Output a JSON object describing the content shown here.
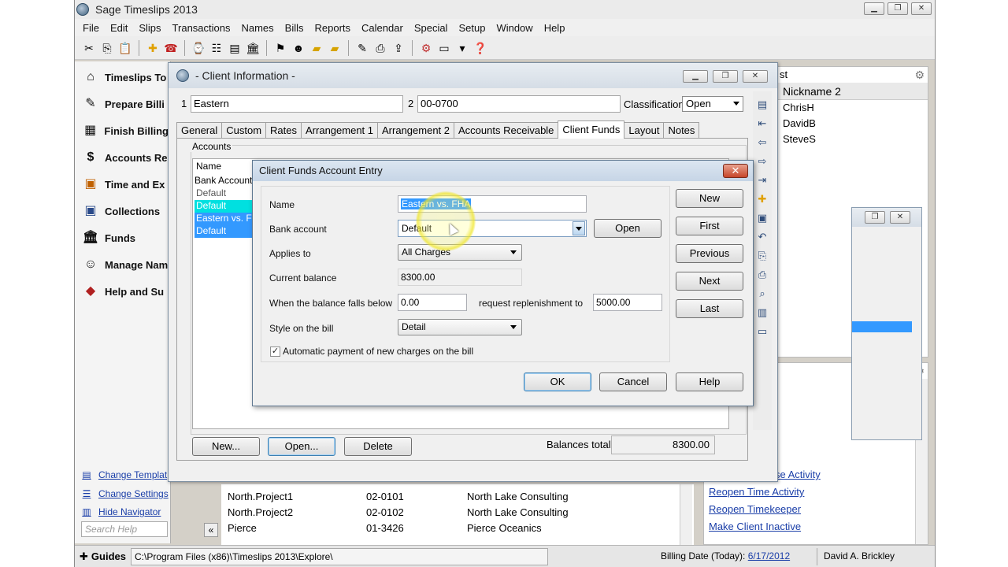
{
  "app": {
    "title": "Sage Timeslips 2013",
    "menu": [
      "File",
      "Edit",
      "Slips",
      "Transactions",
      "Names",
      "Bills",
      "Reports",
      "Calendar",
      "Special",
      "Setup",
      "Window",
      "Help"
    ]
  },
  "navigator": {
    "items": [
      {
        "label": "Timeslips To",
        "icon": "house-icon"
      },
      {
        "label": "Prepare Billi",
        "icon": "prepare-billing-icon"
      },
      {
        "label": "Finish Billing",
        "icon": "finish-billing-icon"
      },
      {
        "label": "Accounts Re",
        "icon": "accounts-receivable-icon"
      },
      {
        "label": "Time and Ex",
        "icon": "time-expense-icon"
      },
      {
        "label": "Collections",
        "icon": "collections-icon"
      },
      {
        "label": "Funds",
        "icon": "funds-icon"
      },
      {
        "label": "Manage Nam",
        "icon": "manage-names-icon"
      },
      {
        "label": "Help and Su",
        "icon": "help-support-icon"
      }
    ],
    "links": [
      "Change Templat",
      "Change Settings",
      "Hide Navigator"
    ],
    "search_placeholder": "Search Help",
    "help_button": "?",
    "collapse": "«"
  },
  "background": {
    "list_rows": [
      {
        "name": "North.Project1",
        "code": "02-0101",
        "company": "North Lake Consulting"
      },
      {
        "name": "North.Project2",
        "code": "02-0102",
        "company": "North Lake Consulting"
      },
      {
        "name": "Pierce",
        "code": "01-3426",
        "company": "Pierce Oceanics"
      }
    ],
    "right_links": [
      "se Activity",
      "Reopen Time Activity",
      "Reopen Timekeeper",
      "Make Client Inactive"
    ],
    "topright_header_frag": "st",
    "topright_column": "Nickname 2",
    "topright_rows": [
      "ChrisH",
      "DavidB",
      "SteveS"
    ]
  },
  "client_info": {
    "title": "- Client Information -",
    "field1_label": "1",
    "field1_value": "Eastern",
    "field2_label": "2",
    "field2_value": "00-0700",
    "classification_label": "Classification",
    "classification_value": "Open",
    "tabs": [
      "General",
      "Custom",
      "Rates",
      "Arrangement 1",
      "Arrangement 2",
      "Accounts Receivable",
      "Client Funds",
      "Layout",
      "Notes"
    ],
    "active_tab": "Client Funds",
    "accounts_label": "Accounts",
    "columns": [
      "Name",
      "Bank Account"
    ],
    "rows": [
      "Default",
      "Default",
      "Eastern vs. FH",
      "Default"
    ],
    "buttons": {
      "new": "New...",
      "open": "Open...",
      "delete": "Delete"
    },
    "balances_label": "Balances total",
    "balances_value": "8300.00"
  },
  "dialog": {
    "title": "Client Funds Account Entry",
    "close": "✕",
    "name_label": "Name",
    "name_value": "Eastern vs. FHA",
    "bank_label": "Bank account",
    "bank_value": "Default",
    "open_button": "Open",
    "applies_label": "Applies to",
    "applies_value": "All Charges",
    "current_label": "Current balance",
    "current_value": "8300.00",
    "falls_label": "When the balance falls below",
    "falls_value": "0.00",
    "replenish_label": "request replenishment to",
    "replenish_value": "5000.00",
    "style_label": "Style on the bill",
    "style_value": "Detail",
    "auto_label": "Automatic payment of new charges on the bill",
    "auto_checked": true,
    "nav_buttons": [
      "New",
      "First",
      "Previous",
      "Next",
      "Last"
    ],
    "ok": "OK",
    "cancel": "Cancel",
    "help": "Help"
  },
  "status": {
    "guides": "Guides",
    "path": "C:\\Program Files (x86)\\Timeslips 2013\\Explore\\",
    "billing_label": "Billing Date (Today):",
    "billing_date": "6/17/2012",
    "user": "David A. Brickley"
  }
}
